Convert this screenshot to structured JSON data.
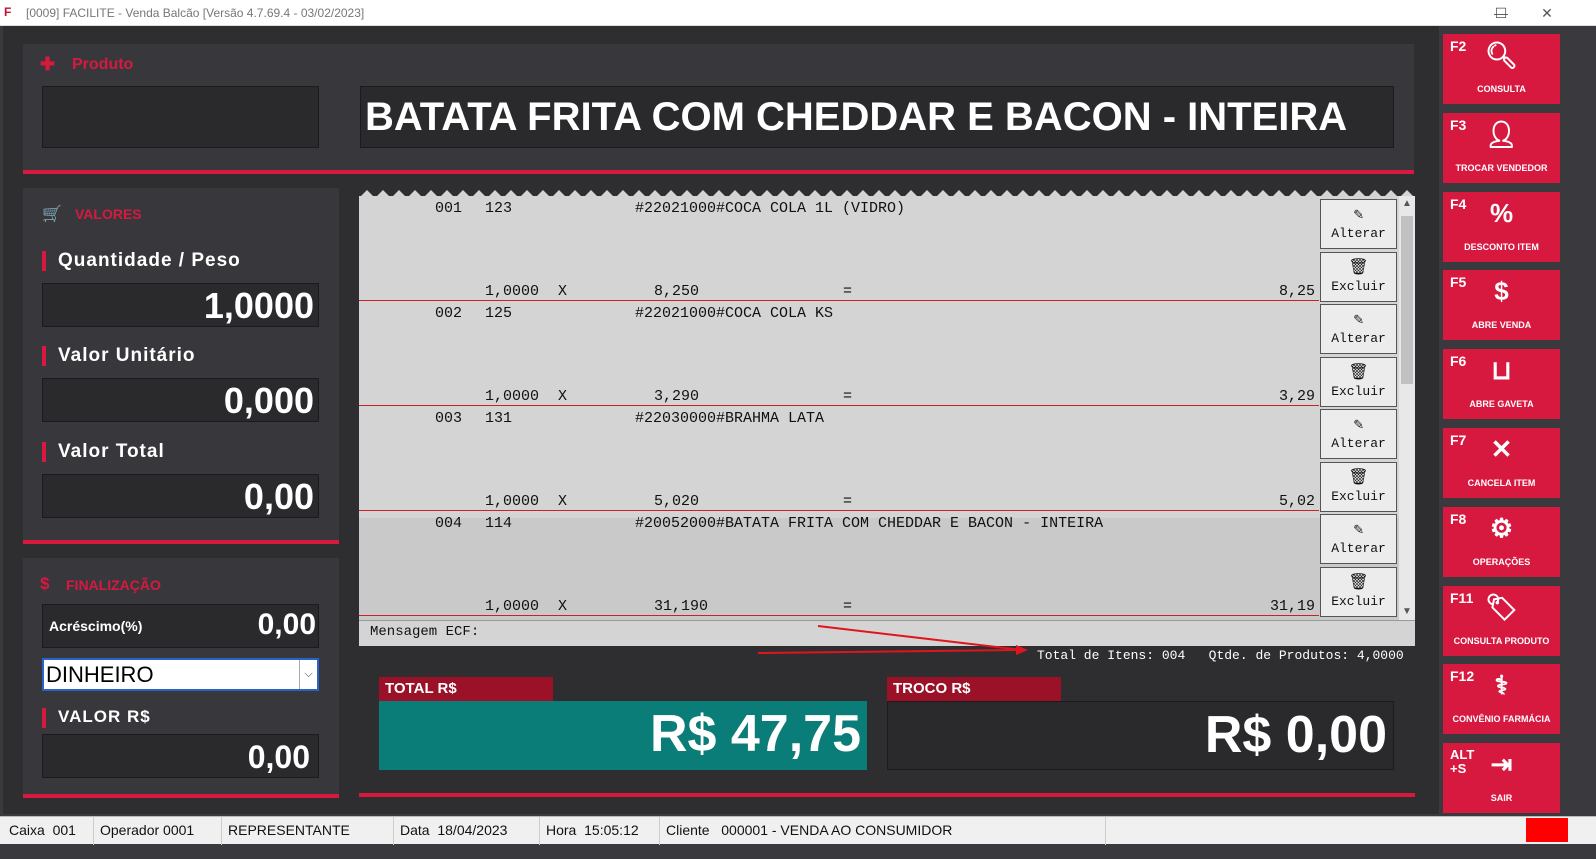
{
  "window": {
    "title": "[0009] FACILITE - Venda Balcão [Versão 4.7.69.4 - 03/02/2023]",
    "minimize": "—",
    "maximize": "☐",
    "close": "✕"
  },
  "produto": {
    "label": "Produto",
    "code": "",
    "description": "BATATA FRITA COM CHEDDAR E BACON - INTEIRA"
  },
  "valores": {
    "header": "VALORES",
    "quantidade_label": "Quantidade / Peso",
    "quantidade": "1,0000",
    "unitario_label": "Valor Unitário",
    "unitario": "0,000",
    "total_label": "Valor Total",
    "total": "0,00"
  },
  "finalizacao": {
    "header": "FINALIZAÇÃO",
    "acrescimo_label": "Acréscimo(%)",
    "acrescimo": "0,00",
    "pagamento": "DINHEIRO",
    "valor_label": "VALOR R$",
    "valor": "0,00"
  },
  "items": [
    {
      "seq": "001",
      "code": "123",
      "desc": "#22021000#COCA COLA 1L (VIDRO)",
      "qty": "1,0000",
      "x": "X",
      "unit": "8,250",
      "eq": "=",
      "total": "8,25"
    },
    {
      "seq": "002",
      "code": "125",
      "desc": "#22021000#COCA COLA KS",
      "qty": "1,0000",
      "x": "X",
      "unit": "3,290",
      "eq": "=",
      "total": "3,29"
    },
    {
      "seq": "003",
      "code": "131",
      "desc": "#22030000#BRAHMA LATA",
      "qty": "1,0000",
      "x": "X",
      "unit": "5,020",
      "eq": "=",
      "total": "5,02"
    },
    {
      "seq": "004",
      "code": "114",
      "desc": "#20052000#BATATA FRITA COM CHEDDAR E BACON - INTEIRA",
      "qty": "1,0000",
      "x": "X",
      "unit": "31,190",
      "eq": "=",
      "total": "31,19"
    }
  ],
  "actions": {
    "alterar": "Alterar",
    "excluir": "Excluir"
  },
  "mensagem": "Mensagem ECF:",
  "summary": {
    "total_itens_label": "Total de Itens:",
    "total_itens": "004",
    "qtde_label": "Qtde. de Produtos:",
    "qtde": "4,0000"
  },
  "totals": {
    "total_label": "TOTAL R$",
    "total": "R$ 47,75",
    "troco_label": "TROCO R$",
    "troco": "R$ 0,00"
  },
  "fkeys": [
    {
      "key": "F2",
      "label": "CONSULTA",
      "icon": "search-icon"
    },
    {
      "key": "F3",
      "label": "TROCAR VENDEDOR",
      "icon": "user-icon"
    },
    {
      "key": "F4",
      "label": "DESCONTO ITEM",
      "icon": "percent-icon"
    },
    {
      "key": "F5",
      "label": "ABRE VENDA",
      "icon": "dollar-icon"
    },
    {
      "key": "F6",
      "label": "ABRE GAVETA",
      "icon": "tray-icon"
    },
    {
      "key": "F7",
      "label": "CANCELA ITEM",
      "icon": "close-icon"
    },
    {
      "key": "F8",
      "label": "OPERAÇÕES",
      "icon": "gear-icon"
    },
    {
      "key": "F11",
      "label": "CONSULTA PRODUTO",
      "icon": "tag-icon"
    },
    {
      "key": "F12",
      "label": "CONVÊNIO FARMÁCIA",
      "icon": "pills-icon"
    },
    {
      "key": "ALT +S",
      "label": "SAIR",
      "icon": "exit-icon"
    }
  ],
  "status": {
    "caixa_label": "Caixa",
    "caixa": "001",
    "operador_label": "Operador",
    "operador": "0001",
    "representante": "REPRESENTANTE",
    "data_label": "Data",
    "data": "18/04/2023",
    "hora_label": "Hora",
    "hora": "15:05:12",
    "cliente_label": "Cliente",
    "cliente": "000001 - VENDA AO CONSUMIDOR"
  },
  "colors": {
    "accent": "#d71940",
    "total_bg": "#0b7d78",
    "panel": "#38383c"
  }
}
